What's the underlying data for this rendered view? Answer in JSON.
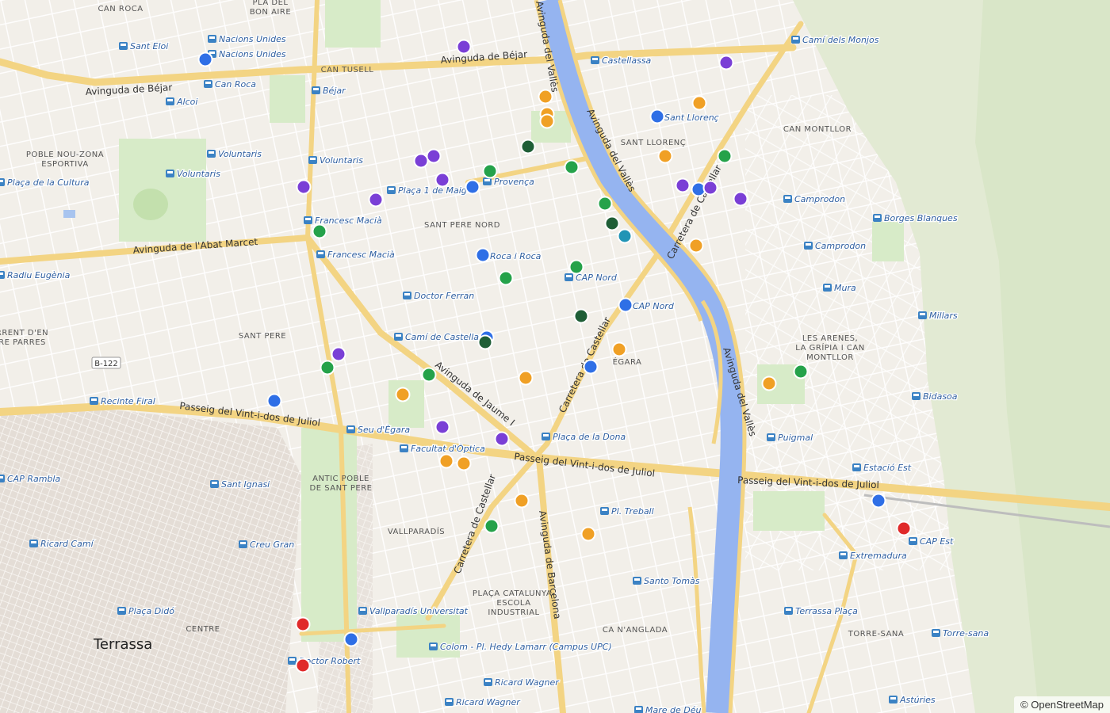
{
  "map": {
    "attribution": "© OpenStreetMap",
    "river_color": "#95b4f0",
    "land_color": "#f2efe9",
    "park_color": "#d7ebc8",
    "road_color": "#f7d98a"
  },
  "marker_colors": {
    "blue": "#2f6fe6",
    "purple": "#7a3fd6",
    "orange": "#f0a025",
    "green": "#25a24a",
    "darkgreen": "#1f5e36",
    "teal": "#2194b5",
    "red": "#e02a2a"
  },
  "streets": {
    "avinguda_bejar_1": "Avinguda de Béjar",
    "avinguda_bejar_2": "Avinguda de Béjar",
    "avinguda_valles_1": "Avinguda del Vallès",
    "avinguda_valles_2": "Avinguda del Vallès",
    "avinguda_valles_3": "Avinguda del Vallès",
    "abat_marcet": "Avinguda de l'Abat Marcet",
    "vint_dos_1": "Passeig del Vint-i-dos de Juliol",
    "vint_dos_2": "Passeig del Vint-i-dos de Juliol",
    "vint_dos_3": "Passeig del Vint-i-dos de Juliol",
    "jaume": "Avinguda de Jaume I",
    "barcelona": "Avinguda de Barcelona",
    "castellar_1": "Carretera de Castellar",
    "castellar_2": "Carretera de Castellar",
    "castellar_3": "Carretera de Castellar",
    "b122": "B-122"
  },
  "districts": [
    {
      "id": "can-roca",
      "lines": [
        "CAN ROCA"
      ]
    },
    {
      "id": "pla-bon-aire",
      "lines": [
        "PLA DEL",
        "BON AIRE"
      ]
    },
    {
      "id": "can-tusell",
      "lines": [
        "CAN TUSELL"
      ]
    },
    {
      "id": "poble-nou",
      "lines": [
        "POBLE NOU-ZONA",
        "ESPORTIVA"
      ]
    },
    {
      "id": "sant-pere-nord",
      "lines": [
        "SANT PERE NORD"
      ]
    },
    {
      "id": "sant-llorenc",
      "lines": [
        "SANT LLORENÇ"
      ]
    },
    {
      "id": "can-montllor",
      "lines": [
        "CAN MONTLLOR"
      ]
    },
    {
      "id": "torrent",
      "lines": [
        "RRENT D'EN",
        "RE PARRES"
      ]
    },
    {
      "id": "sant-pere",
      "lines": [
        "SANT PERE"
      ]
    },
    {
      "id": "les-arenes",
      "lines": [
        "LES ARENES,",
        "LA GRÍPIA I CAN",
        "MONTLLOR"
      ]
    },
    {
      "id": "egara",
      "lines": [
        "ÉGARA"
      ]
    },
    {
      "id": "antic-poble",
      "lines": [
        "ANTIC POBLE",
        "DE SANT PERE"
      ]
    },
    {
      "id": "vallparadis",
      "lines": [
        "VALLPARADÍS"
      ]
    },
    {
      "id": "placa-catalunya",
      "lines": [
        "PLAÇA CATALUNYA-",
        "ESCOLA",
        "INDUSTRIAL"
      ]
    },
    {
      "id": "centre",
      "lines": [
        "CENTRE"
      ]
    },
    {
      "id": "ca-nanglada",
      "lines": [
        "CA N'ANGLADA"
      ]
    },
    {
      "id": "torre-sana",
      "lines": [
        "TORRE-SANA"
      ]
    }
  ],
  "city": "Terrassa",
  "stops": [
    {
      "name": "Sant Eloi"
    },
    {
      "name": "Nacions Unides"
    },
    {
      "name": "Nacions Unides"
    },
    {
      "name": "Can Roca"
    },
    {
      "name": "Alcoi"
    },
    {
      "name": "Béjar"
    },
    {
      "name": "Castellassa"
    },
    {
      "name": "Camí dels Monjos"
    },
    {
      "name": "Sant Llorenç"
    },
    {
      "name": "Voluntaris"
    },
    {
      "name": "Voluntaris"
    },
    {
      "name": "Voluntaris"
    },
    {
      "name": "Plaça de la Cultura"
    },
    {
      "name": "Plaça 1 de Maig"
    },
    {
      "name": "Provença"
    },
    {
      "name": "Camprodon"
    },
    {
      "name": "Borges Blanques"
    },
    {
      "name": "Francesc Macià"
    },
    {
      "name": "Francesc Macià"
    },
    {
      "name": "Roca i Roca"
    },
    {
      "name": "Camprodon"
    },
    {
      "name": "CAP Nord"
    },
    {
      "name": "Mura"
    },
    {
      "name": "CAP Nord"
    },
    {
      "name": "Doctor Ferran"
    },
    {
      "name": "Millars"
    },
    {
      "name": "Camí de Castellar"
    },
    {
      "name": "Recinte Firal"
    },
    {
      "name": "Bidasoa"
    },
    {
      "name": "Seu d'Ègara"
    },
    {
      "name": "Plaça de la Dona"
    },
    {
      "name": "Puigmal"
    },
    {
      "name": "Facultat d'Òptica"
    },
    {
      "name": "Estació Est"
    },
    {
      "name": "CAP Rambla"
    },
    {
      "name": "Sant Ignasi"
    },
    {
      "name": "Pl. Treball"
    },
    {
      "name": "CAP Est"
    },
    {
      "name": "Ricard Camí"
    },
    {
      "name": "Creu Gran"
    },
    {
      "name": "Extremadura"
    },
    {
      "name": "Santo Tomàs"
    },
    {
      "name": "Plaça Didó"
    },
    {
      "name": "Vallparadís Universitat"
    },
    {
      "name": "Terrassa Plaça"
    },
    {
      "name": "Torre-sana"
    },
    {
      "name": "Colom - Pl. Hedy Lamarr (Campus UPC)"
    },
    {
      "name": "Doctor Robert"
    },
    {
      "name": "Ricard Wagner"
    },
    {
      "name": "Ricard Wagner"
    },
    {
      "name": "Astúries"
    },
    {
      "name": "Mare de Déu"
    },
    {
      "name": "Radiu Eugènia"
    }
  ],
  "markers": [
    {
      "color": "blue"
    },
    {
      "color": "purple"
    },
    {
      "color": "purple"
    },
    {
      "color": "orange"
    },
    {
      "color": "orange"
    },
    {
      "color": "orange"
    },
    {
      "color": "orange"
    },
    {
      "color": "blue"
    },
    {
      "color": "darkgreen"
    },
    {
      "color": "orange"
    },
    {
      "color": "green"
    },
    {
      "color": "purple"
    },
    {
      "color": "purple"
    },
    {
      "color": "purple"
    },
    {
      "color": "green"
    },
    {
      "color": "green"
    },
    {
      "color": "purple"
    },
    {
      "color": "purple"
    },
    {
      "color": "blue"
    },
    {
      "color": "purple"
    },
    {
      "color": "blue"
    },
    {
      "color": "purple"
    },
    {
      "color": "purple"
    },
    {
      "color": "green"
    },
    {
      "color": "darkgreen"
    },
    {
      "color": "teal"
    },
    {
      "color": "green"
    },
    {
      "color": "orange"
    },
    {
      "color": "blue"
    },
    {
      "color": "green"
    },
    {
      "color": "green"
    },
    {
      "color": "blue"
    },
    {
      "color": "darkgreen"
    },
    {
      "color": "blue"
    },
    {
      "color": "darkgreen"
    },
    {
      "color": "orange"
    },
    {
      "color": "purple"
    },
    {
      "color": "green"
    },
    {
      "color": "blue"
    },
    {
      "color": "green"
    },
    {
      "color": "orange"
    },
    {
      "color": "green"
    },
    {
      "color": "orange"
    },
    {
      "color": "orange"
    },
    {
      "color": "blue"
    },
    {
      "color": "purple"
    },
    {
      "color": "purple"
    },
    {
      "color": "orange"
    },
    {
      "color": "orange"
    },
    {
      "color": "orange"
    },
    {
      "color": "blue"
    },
    {
      "color": "green"
    },
    {
      "color": "orange"
    },
    {
      "color": "red"
    },
    {
      "color": "red"
    },
    {
      "color": "blue"
    },
    {
      "color": "red"
    }
  ]
}
